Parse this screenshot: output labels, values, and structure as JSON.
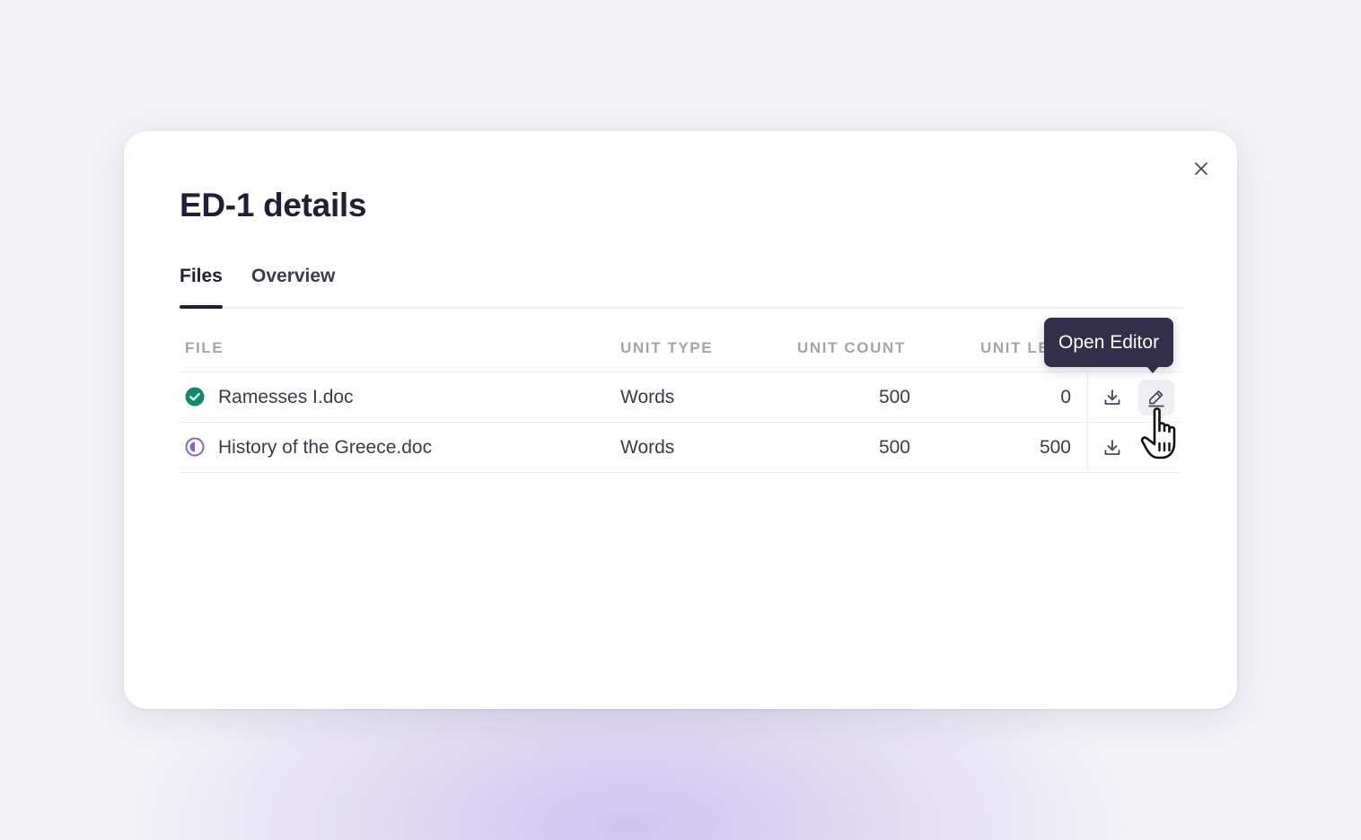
{
  "modal": {
    "title": "ED-1 details",
    "tabs": [
      {
        "label": "Files",
        "active": true
      },
      {
        "label": "Overview",
        "active": false
      }
    ]
  },
  "table": {
    "columns": [
      "FILE",
      "UNIT TYPE",
      "UNIT COUNT",
      "UNIT LE"
    ],
    "rows": [
      {
        "status": "completed",
        "status_icon": "check-circle-icon",
        "file": "Ramesses I.doc",
        "unit_type": "Words",
        "unit_count": "500",
        "unit_left": "0"
      },
      {
        "status": "in-progress",
        "status_icon": "half-circle-icon",
        "file": "History of the Greece.doc",
        "unit_type": "Words",
        "unit_count": "500",
        "unit_left": "500"
      }
    ]
  },
  "tooltip": {
    "text": "Open Editor"
  },
  "colors": {
    "accent_dark": "#211f33",
    "tooltip_bg": "#322f4b",
    "status_completed": "#0f8a6c",
    "status_in_progress": "#8a63c8"
  }
}
